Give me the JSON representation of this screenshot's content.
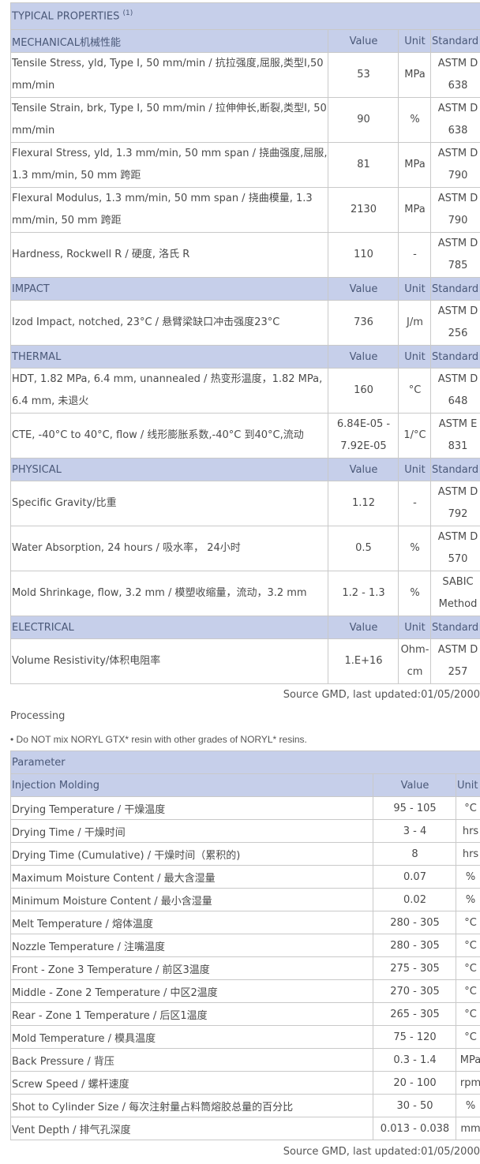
{
  "typical": {
    "title": "TYPICAL PROPERTIES",
    "title_note": "(1)",
    "sections": [
      {
        "name": "MECHANICAL机械性能",
        "col_value": "Value",
        "col_unit": "Unit",
        "col_standard": "Standard",
        "rows": [
          {
            "property": "Tensile Stress, yld, Type I, 50 mm/min / 抗拉强度,屈服,类型I,50 mm/min",
            "value": "53",
            "unit": "MPa",
            "standard": [
              "ASTM D",
              "638"
            ]
          },
          {
            "property": "Tensile Strain, brk, Type I, 50 mm/min / 拉伸伸长,断裂,类型I, 50 mm/min",
            "value": "90",
            "unit": "%",
            "standard": [
              "ASTM D",
              "638"
            ]
          },
          {
            "property": "Flexural Stress, yld, 1.3 mm/min, 50 mm span / 挠曲强度,屈服, 1.3 mm/min, 50 mm 跨距",
            "value": "81",
            "unit": "MPa",
            "standard": [
              "ASTM D",
              "790"
            ]
          },
          {
            "property": "Flexural Modulus, 1.3 mm/min, 50 mm span / 挠曲模量, 1.3 mm/min, 50 mm 跨距",
            "value": "2130",
            "unit": "MPa",
            "standard": [
              "ASTM D",
              "790"
            ]
          },
          {
            "property": "Hardness, Rockwell R / 硬度, 洛氏 R",
            "value": "110",
            "unit": "-",
            "standard": [
              "ASTM D",
              "785"
            ]
          }
        ]
      },
      {
        "name": "IMPACT",
        "col_value": "Value",
        "col_unit": "Unit",
        "col_standard": "Standard",
        "rows": [
          {
            "property": "Izod Impact, notched, 23°C / 悬臂梁缺口冲击强度23°C",
            "value": "736",
            "unit": "J/m",
            "standard": [
              "ASTM D",
              "256"
            ]
          }
        ]
      },
      {
        "name": "THERMAL",
        "col_value": "Value",
        "col_unit": "Unit",
        "col_standard": "Standard",
        "rows": [
          {
            "property": "HDT, 1.82 MPa, 6.4 mm, unannealed / 热变形温度，1.82 MPa, 6.4 mm, 未退火",
            "value": "160",
            "unit": "°C",
            "standard": [
              "ASTM D",
              "648"
            ]
          },
          {
            "property": "CTE, -40°C to 40°C, flow / 线形膨胀系数,-40°C 到40°C,流动",
            "value": "6.84E-05 - 7.92E-05",
            "unit": "1/°C",
            "standard": [
              "ASTM E",
              "831"
            ]
          }
        ]
      },
      {
        "name": "PHYSICAL",
        "col_value": "Value",
        "col_unit": "Unit",
        "col_standard": "Standard",
        "rows": [
          {
            "property": "Specific Gravity/比重",
            "value": "1.12",
            "unit": "-",
            "standard": [
              "ASTM D",
              "792"
            ]
          },
          {
            "property": "Water Absorption, 24 hours / 吸水率， 24小时",
            "value": "0.5",
            "unit": "%",
            "standard": [
              "ASTM D",
              "570"
            ]
          },
          {
            "property": "Mold Shrinkage, flow, 3.2 mm / 模塑收缩量，流动，3.2 mm",
            "value": "1.2 - 1.3",
            "unit": "%",
            "standard": [
              "SABIC",
              "Method"
            ]
          }
        ]
      },
      {
        "name": "ELECTRICAL",
        "col_value": "Value",
        "col_unit": "Unit",
        "col_standard": "Standard",
        "rows": [
          {
            "property": "Volume Resistivity/体积电阻率",
            "value": "1.E+16",
            "unit": "Ohm-cm",
            "standard": [
              "ASTM D",
              "257"
            ]
          }
        ]
      }
    ],
    "source": "Source GMD, last updated:01/05/2000"
  },
  "processing": {
    "heading": "Processing",
    "note": "• Do NOT mix NORYL GTX* resin with other grades of NORYL* resins.",
    "param_header": "Parameter",
    "group": "Injection Molding",
    "col_value": "Value",
    "col_unit": "Unit",
    "rows": [
      {
        "param": "Drying Temperature / 干燥温度",
        "value": "95 - 105",
        "unit": "°C"
      },
      {
        "param": "Drying Time / 干燥时间",
        "value": "3 - 4",
        "unit": "hrs"
      },
      {
        "param": "Drying Time (Cumulative) / 干燥时间（累积的)",
        "value": "8",
        "unit": "hrs"
      },
      {
        "param": "Maximum Moisture Content / 最大含湿量",
        "value": "0.07",
        "unit": "%"
      },
      {
        "param": "Minimum Moisture Content / 最小含湿量",
        "value": "0.02",
        "unit": "%"
      },
      {
        "param": "Melt Temperature / 熔体温度",
        "value": "280 - 305",
        "unit": "°C"
      },
      {
        "param": "Nozzle Temperature / 注嘴温度",
        "value": "280 - 305",
        "unit": "°C"
      },
      {
        "param": "Front - Zone 3 Temperature / 前区3温度",
        "value": "275 - 305",
        "unit": "°C"
      },
      {
        "param": "Middle - Zone 2 Temperature / 中区2温度",
        "value": "270 - 305",
        "unit": "°C"
      },
      {
        "param": "Rear - Zone 1 Temperature / 后区1温度",
        "value": "265 - 305",
        "unit": "°C"
      },
      {
        "param": "Mold Temperature / 模具温度",
        "value": "75 - 120",
        "unit": "°C"
      },
      {
        "param": "Back Pressure / 背压",
        "value": "0.3 - 1.4",
        "unit": "MPa"
      },
      {
        "param": "Screw Speed / 螺杆速度",
        "value": "20 - 100",
        "unit": "rpm"
      },
      {
        "param": "Shot to Cylinder Size / 每次注射量占料筒熔胶总量的百分比",
        "value": "30 - 50",
        "unit": "%"
      },
      {
        "param": "Vent Depth / 排气孔深度",
        "value": "0.013 - 0.038",
        "unit": "mm"
      }
    ],
    "source": "Source GMD, last updated:01/05/2000"
  }
}
